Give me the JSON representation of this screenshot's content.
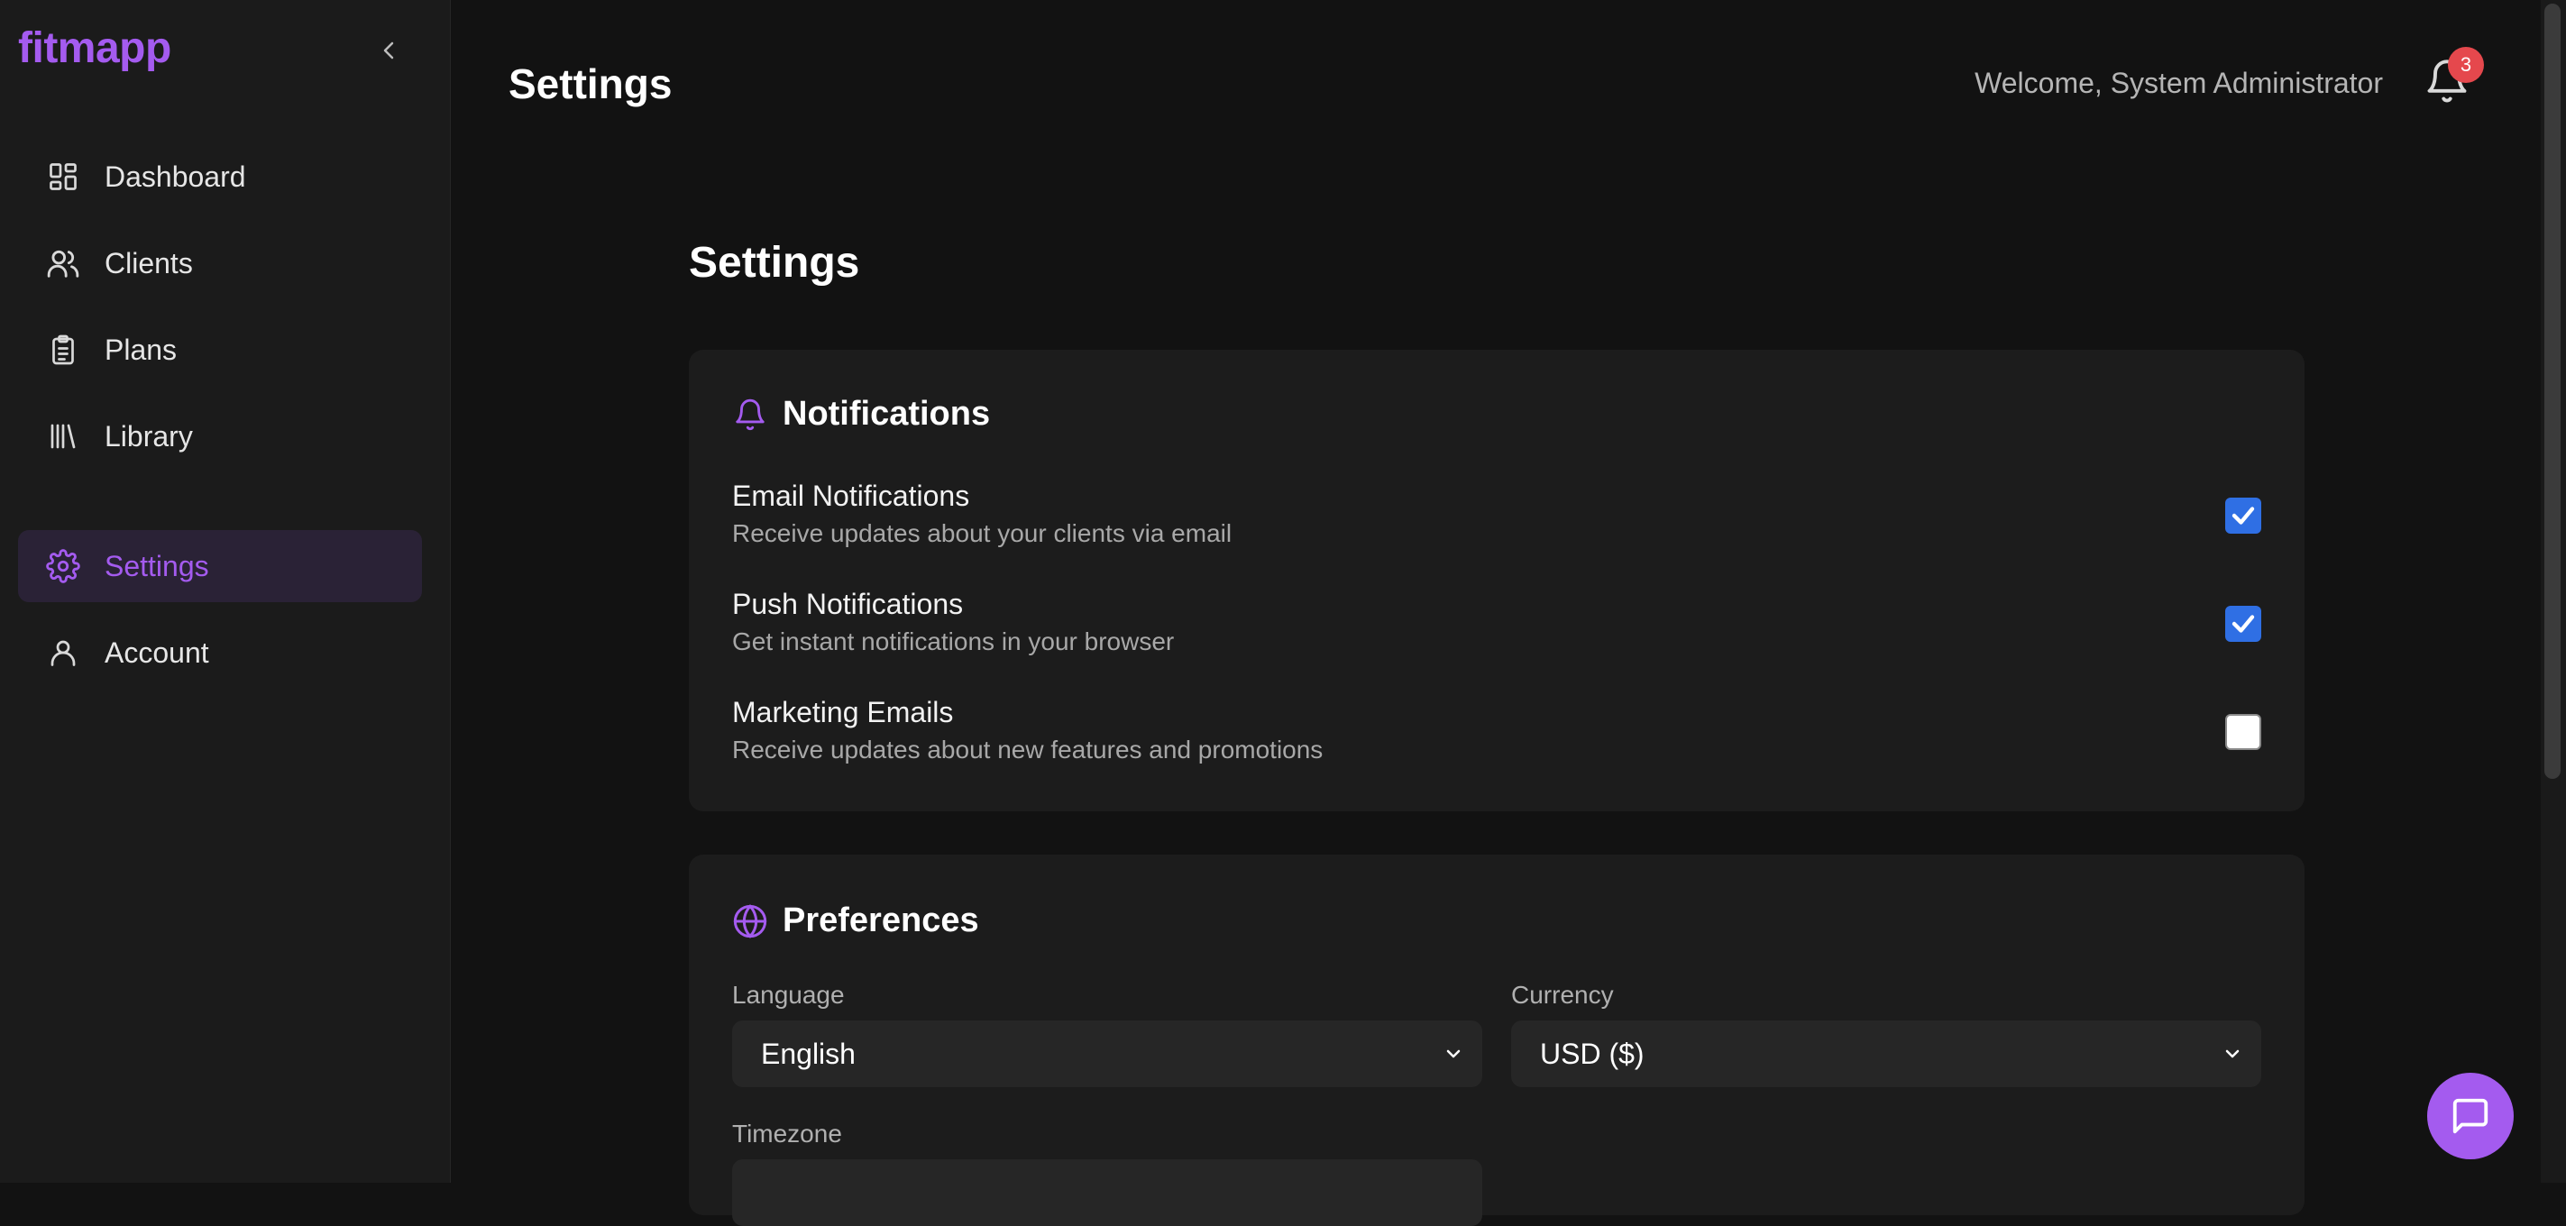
{
  "app": {
    "logo": "fitmapp"
  },
  "sidebar": {
    "items": [
      {
        "label": "Dashboard",
        "icon": "dashboard-icon"
      },
      {
        "label": "Clients",
        "icon": "users-icon"
      },
      {
        "label": "Plans",
        "icon": "clipboard-icon"
      },
      {
        "label": "Library",
        "icon": "library-icon"
      },
      {
        "label": "Settings",
        "icon": "gear-icon",
        "active": true
      },
      {
        "label": "Account",
        "icon": "user-icon"
      }
    ]
  },
  "header": {
    "title": "Settings",
    "welcome": "Welcome, System Administrator",
    "notification_count": "3"
  },
  "main": {
    "title": "Settings",
    "notifications": {
      "title": "Notifications",
      "rows": [
        {
          "title": "Email Notifications",
          "description": "Receive updates about your clients via email",
          "checked": true
        },
        {
          "title": "Push Notifications",
          "description": "Get instant notifications in your browser",
          "checked": true
        },
        {
          "title": "Marketing Emails",
          "description": "Receive updates about new features and promotions",
          "checked": false
        }
      ]
    },
    "preferences": {
      "title": "Preferences",
      "language_label": "Language",
      "language_value": "English",
      "currency_label": "Currency",
      "currency_value": "USD ($)",
      "timezone_label": "Timezone"
    }
  },
  "colors": {
    "accent": "#a45bef",
    "checkbox": "#2f6fe4",
    "badge": "#e5484d",
    "background": "#121212",
    "sidebar": "#1b1b1b",
    "card": "#1c1c1c"
  }
}
